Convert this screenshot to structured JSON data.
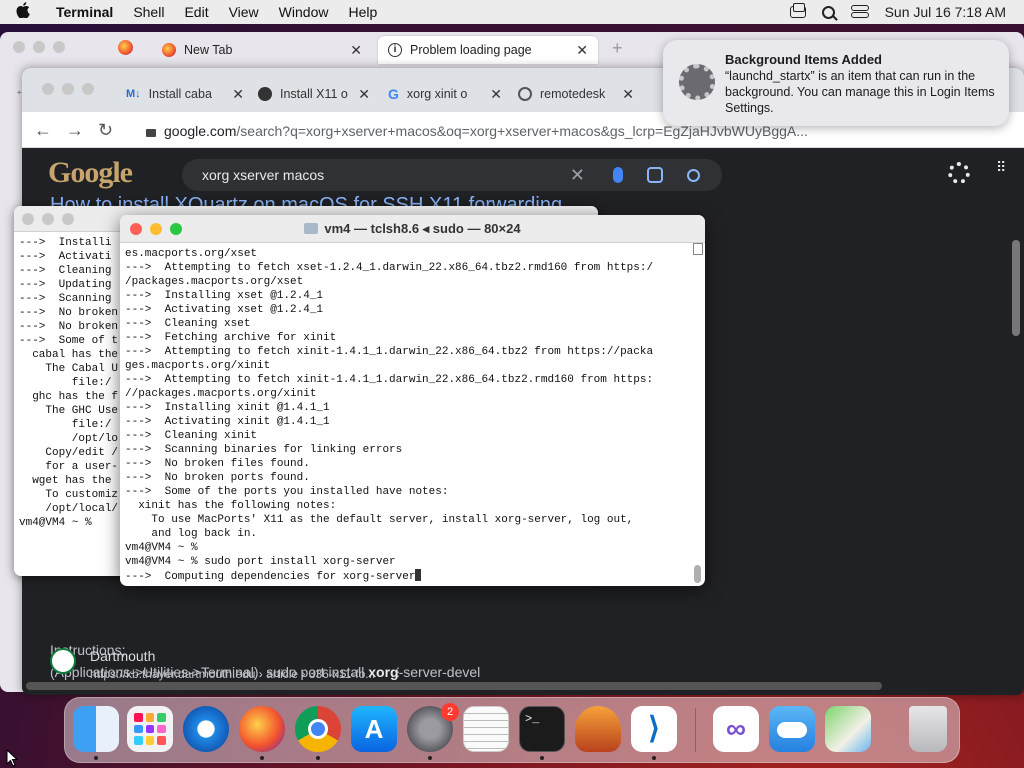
{
  "menubar": {
    "app": "Terminal",
    "items": [
      "Shell",
      "Edit",
      "View",
      "Window",
      "Help"
    ],
    "clock": "Sun Jul 16  7:18 AM"
  },
  "firefox": {
    "tabs": [
      {
        "label": "New Tab",
        "active": false
      },
      {
        "label": "Problem loading page",
        "active": true
      }
    ]
  },
  "chrome": {
    "tabs": [
      "Install caba",
      "Install X11 o",
      "xorg xinit o",
      "remotedesk"
    ],
    "url_domain": "google.com",
    "url_rest": "/search?q=xorg+xserver+macos&oq=xorg+xserver+macos&gs_lcrp=EgZjaHJvbWUyBggA...",
    "search_query": "xorg xserver macos",
    "result_title": "How to install XQuartz on macOS for SSH X11 forwarding",
    "snippet_line1": "Instructions;",
    "snippet_line2_pre": "(Applications->Utilities->Terminal). sudo port install ",
    "snippet_line2_bold": "xorg",
    "snippet_line2_post": "-server-devel",
    "result2_site": "Dartmouth",
    "result2_url": "https://kb.thayer.dartmouth.edu › article › 336-x11-fo..."
  },
  "term_back": {
    "lines": [
      "--->  Installi",
      "--->  Activati",
      "--->  Cleaning",
      "--->  Updating",
      "--->  Scanning",
      "--->  No broken",
      "--->  No broken",
      "--->  Some of t",
      "  cabal has the",
      "    The Cabal U",
      "",
      "        file:/",
      "  ghc has the f",
      "    The GHC Use",
      "",
      "        file:/",
      "        /opt/lo",
      "",
      "    Copy/edit /",
      "    for a user-",
      "  wget has the",
      "    To customiz",
      "    /opt/local/",
      "vm4@VM4 ~ % "
    ]
  },
  "terminal": {
    "title": "vm4 — tclsh8.6 ◂ sudo — 80×24",
    "lines": [
      "es.macports.org/xset",
      "--->  Attempting to fetch xset-1.2.4_1.darwin_22.x86_64.tbz2.rmd160 from https:/",
      "/packages.macports.org/xset",
      "--->  Installing xset @1.2.4_1",
      "--->  Activating xset @1.2.4_1",
      "--->  Cleaning xset",
      "--->  Fetching archive for xinit",
      "--->  Attempting to fetch xinit-1.4.1_1.darwin_22.x86_64.tbz2 from https://packa",
      "ges.macports.org/xinit",
      "--->  Attempting to fetch xinit-1.4.1_1.darwin_22.x86_64.tbz2.rmd160 from https:",
      "//packages.macports.org/xinit",
      "--->  Installing xinit @1.4.1_1",
      "--->  Activating xinit @1.4.1_1",
      "--->  Cleaning xinit",
      "--->  Scanning binaries for linking errors",
      "--->  No broken files found.",
      "--->  No broken ports found.",
      "--->  Some of the ports you installed have notes:",
      "  xinit has the following notes:",
      "    To use MacPorts' X11 as the default server, install xorg-server, log out,",
      "    and log back in.",
      "vm4@VM4 ~ %",
      "vm4@VM4 ~ % sudo port install xorg-server",
      "--->  Computing dependencies for xorg-server"
    ]
  },
  "notification": {
    "title": "Background Items Added",
    "body": "“launchd_startx” is an item that can run in the background. You can manage this in Login Items Settings."
  },
  "dock": {
    "apps": [
      "finder-icon",
      "launchpad-icon",
      "safari-icon",
      "firefox-icon",
      "chrome-icon",
      "app-store-icon",
      "system-settings-icon",
      "textedit-icon",
      "terminal-icon",
      "garageband-icon",
      "vscode-icon",
      "visual-studio-icon",
      "weather-icon",
      "maps-icon",
      "trash-icon"
    ],
    "settings_badge": "2"
  }
}
